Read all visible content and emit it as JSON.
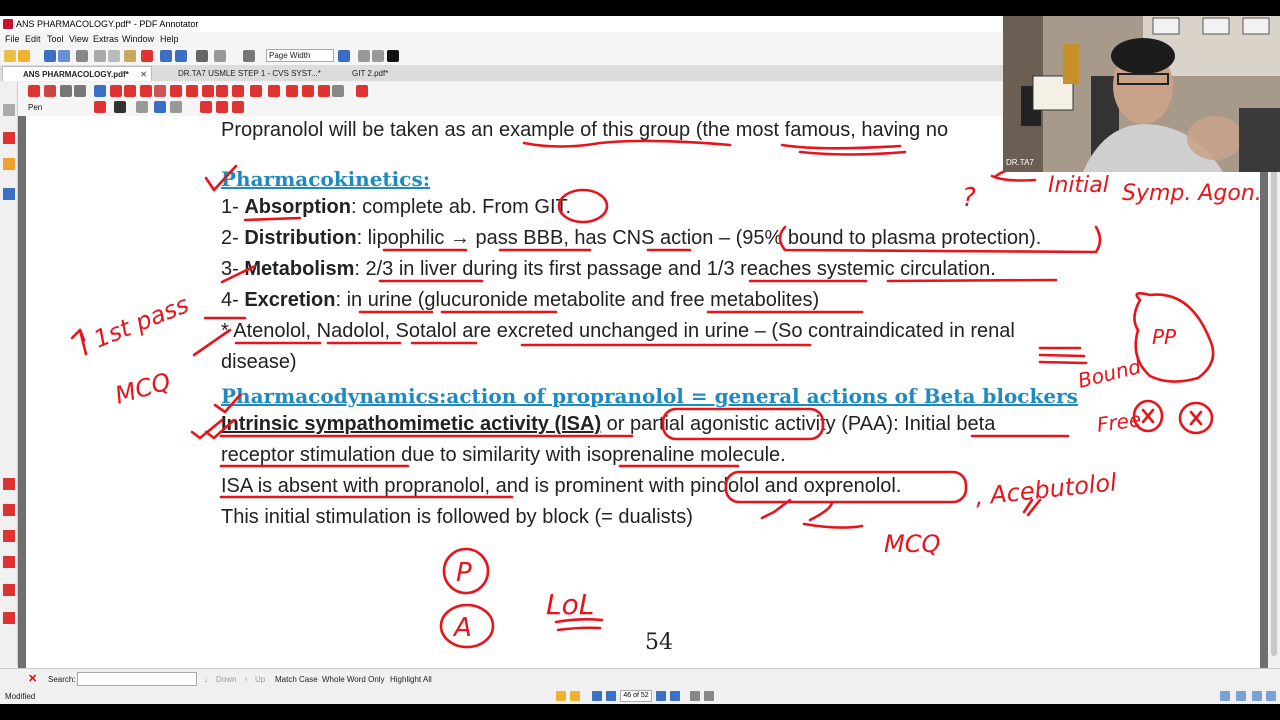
{
  "window": {
    "title": "ANS PHARMACOLOGY.pdf* - PDF Annotator"
  },
  "menu": [
    "File",
    "Edit",
    "Tool",
    "View",
    "Extras",
    "Window",
    "Help"
  ],
  "toolbar": {
    "zoom_mode": "Page Width",
    "pen_label": "Pen"
  },
  "tabs": [
    {
      "label": "ANS PHARMACOLOGY.pdf*",
      "active": true
    },
    {
      "label": "DR.TA7 USMLE STEP 1 - CVS SYST...*",
      "active": false
    },
    {
      "label": "GIT 2.pdf*",
      "active": false
    }
  ],
  "document": {
    "line_intro": "Propranolol will be taken as an example of this group (the most famous, having no",
    "heading_kinetics": "Pharmacokinetics:",
    "absorption": {
      "num": "1- ",
      "term": "Absorption",
      "rest": ": complete ab. From GIT."
    },
    "distribution": {
      "num": "2- ",
      "term": "Distribution",
      "rest": ": lipophilic → pass BBB, has CNS action – (95% bound to plasma protection)."
    },
    "metabolism": {
      "num": "3- ",
      "term": "Metabolism",
      "rest": ": 2/3 in liver during its first passage and 1/3 reaches systemic circulation."
    },
    "excretion": {
      "num": "4- ",
      "term": "Excretion",
      "rest": ": in urine (glucuronide metabolite and free metabolites)"
    },
    "note_line1": "* Atenolol, Nadolol, Sotalol are excreted unchanged in urine – (So contraindicated in renal",
    "note_line2": "disease)",
    "heading_dynamics": "Pharmacodynamics:action of propranolol = general actions of Beta blockers",
    "isa_term": "Intrinsic sympathomimetic activity (ISA)",
    "isa_rest": " or partial agonistic activity  (PAA): Initial beta",
    "isa_line2": "receptor stimulation due to similarity with isoprenaline molecule.",
    "isa_line3": "ISA is absent with propranolol, and is prominent with pindolol and oxprenolol.",
    "isa_line4": "This initial stimulation is followed by block (= dualists)",
    "page_number": "54"
  },
  "ink": {
    "q_mark": "?",
    "initial": "Initial",
    "symp_agon": "Symp. Agon.",
    "first_pass": "1st pass",
    "mcq_left": "MCQ",
    "pp": "PP",
    "bound": "Bound",
    "free": "Free",
    "acebutolol": ", Acebutolol",
    "mcq_right": "MCQ",
    "p_circle": "P",
    "a_circle": "A",
    "lol": "LoL"
  },
  "webcam": {
    "label": "DR.TA7"
  },
  "search": {
    "label": "Search:",
    "value": "",
    "down": "Down",
    "up": "Up",
    "match_case": "Match Case",
    "whole_word": "Whole Word Only",
    "highlight_all": "Highlight All"
  },
  "status": {
    "modified": "Modified",
    "page_indicator": "46 of 52"
  },
  "colors": {
    "ink": "#e8141c",
    "heading": "#1f8ac0",
    "page_bg": "#ffffff",
    "gutter": "#6f6f6f"
  }
}
